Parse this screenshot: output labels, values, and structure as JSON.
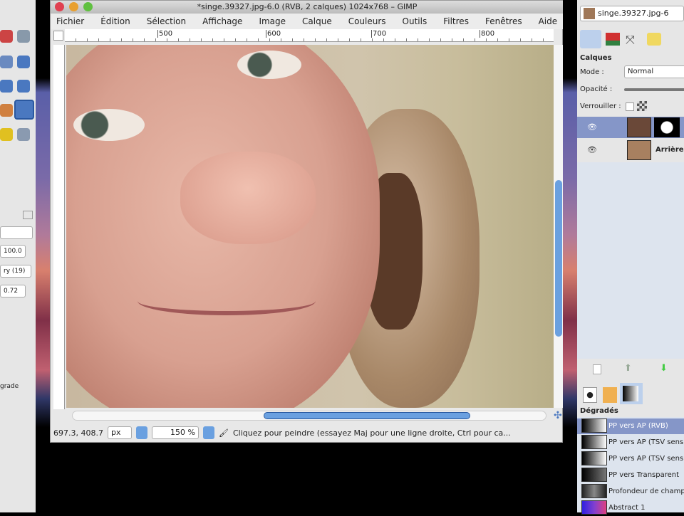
{
  "window": {
    "title": "*singe.39327.jpg-6.0 (RVB, 2 calques) 1024x768 – GIMP"
  },
  "menu": [
    "Fichier",
    "Édition",
    "Sélection",
    "Affichage",
    "Image",
    "Calque",
    "Couleurs",
    "Outils",
    "Filtres",
    "Fenêtres",
    "Aide"
  ],
  "ruler": {
    "marks": [
      "500",
      "600",
      "700",
      "800"
    ]
  },
  "status": {
    "coords": "697.3, 408.7",
    "unit": "px",
    "zoom": "150 %",
    "message": "Cliquez pour peindre (essayez Maj pour une ligne droite, Ctrl pour ca..."
  },
  "toolbox": {
    "opts": [
      "100.0",
      "ry (19)",
      "0.72"
    ],
    "label": "grade"
  },
  "dock": {
    "image_name": "singe.39327.jpg-6",
    "layers_title": "Calques",
    "mode_label": "Mode :",
    "mode_value": "Normal",
    "opacity_label": "Opacité :",
    "lock_label": "Verrouiller :",
    "layers": [
      {
        "name": ""
      },
      {
        "name": "Arrière-plan"
      }
    ],
    "gradients_title": "Dégradés",
    "gradients": [
      {
        "name": "PP vers AP (RVB)",
        "css": "linear-gradient(90deg,#000,#fff)"
      },
      {
        "name": "PP vers AP (TSV sens...",
        "css": "linear-gradient(90deg,#000,#fff)"
      },
      {
        "name": "PP vers AP (TSV sens...",
        "css": "linear-gradient(90deg,#000,#fff)"
      },
      {
        "name": "PP vers Transparent",
        "css": "linear-gradient(90deg,#000,#777)"
      },
      {
        "name": "Profondeur de champ",
        "css": "linear-gradient(90deg,#222,#888,#222)"
      },
      {
        "name": "Abstract 1",
        "css": "linear-gradient(90deg,#3020e0,#8040d0,#e04080)"
      }
    ]
  },
  "colors": {
    "selection": "#8596c8",
    "accent": "#6aa0e0"
  }
}
